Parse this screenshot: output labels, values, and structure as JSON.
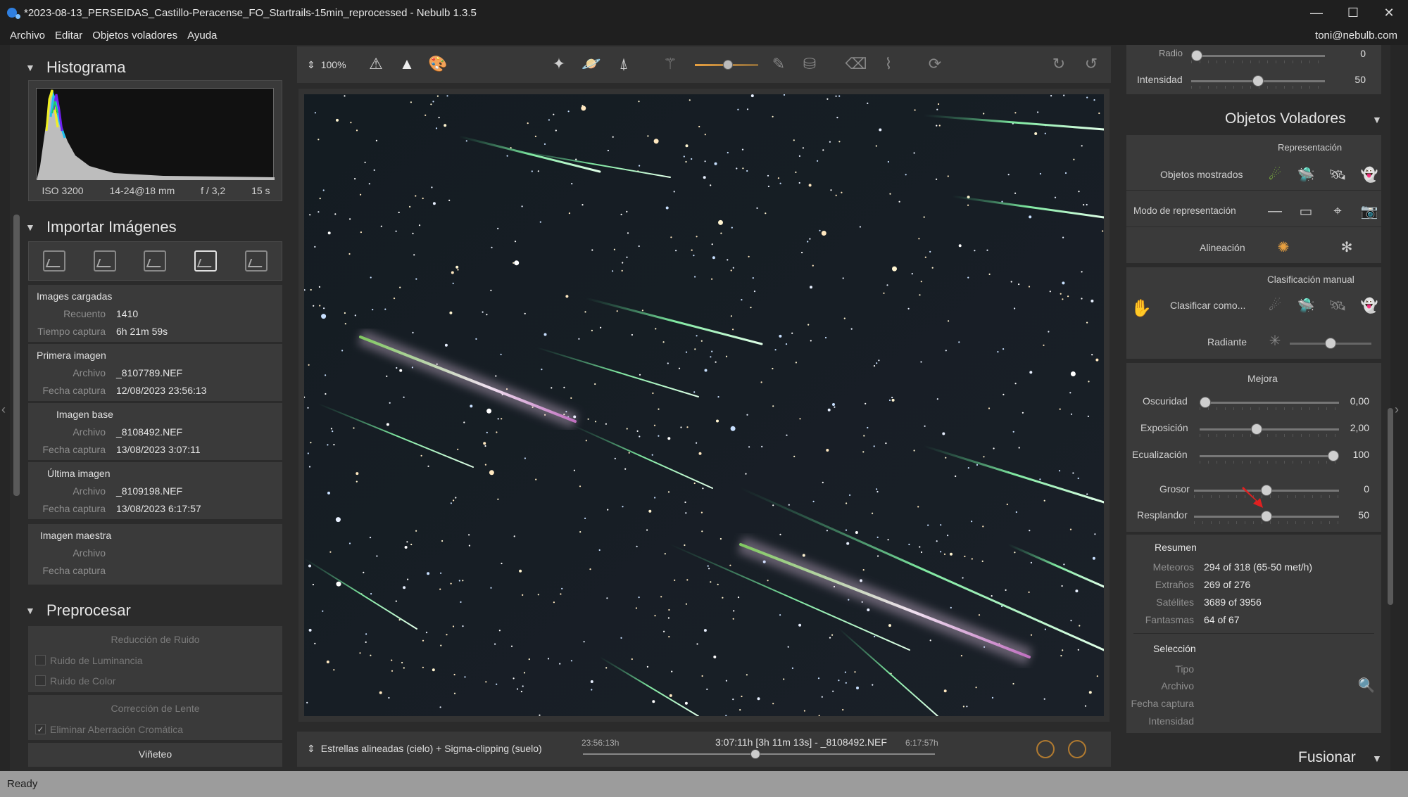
{
  "window": {
    "title": "*2023-08-13_PERSEIDAS_Castillo-Peracense_FO_Startrails-15min_reprocessed - Nebulb 1.3.5",
    "minimize": "—",
    "maximize": "☐",
    "close": "✕"
  },
  "menu": {
    "items": [
      "Archivo",
      "Editar",
      "Objetos voladores",
      "Ayuda"
    ],
    "user": "toni@nebulb.com"
  },
  "histogram": {
    "title": "Histograma",
    "iso": "ISO 3200",
    "lens": "14-24@18 mm",
    "aperture": "f / 3,2",
    "exposure": "15 s"
  },
  "import": {
    "title": "Importar Imágenes",
    "loaded": {
      "heading": "Images cargadas",
      "count_label": "Recuento",
      "count": "1410",
      "time_label": "Tiempo captura",
      "time": "6h 21m 59s"
    },
    "first": {
      "heading": "Primera imagen",
      "file_label": "Archivo",
      "file": "_8107789.NEF",
      "date_label": "Fecha captura",
      "date": "12/08/2023 23:56:13"
    },
    "base": {
      "heading": "Imagen base",
      "file_label": "Archivo",
      "file": "_8108492.NEF",
      "date_label": "Fecha captura",
      "date": "13/08/2023 3:07:11"
    },
    "last": {
      "heading": "Última imagen",
      "file_label": "Archivo",
      "file": "_8109198.NEF",
      "date_label": "Fecha captura",
      "date": "13/08/2023 6:17:57"
    },
    "master": {
      "heading": "Imagen maestra",
      "file_label": "Archivo",
      "date_label": "Fecha captura"
    }
  },
  "preprocess": {
    "title": "Preprocesar",
    "noise_heading": "Reducción de Ruido",
    "luminance": "Ruido de Luminancia",
    "color": "Ruido de Color",
    "lens_heading": "Corrección de Lente",
    "chromatic": "Eliminar Aberración Cromática",
    "chromatic_checked": true,
    "vignette": "Viñeteo"
  },
  "toolbar": {
    "zoom": "100%"
  },
  "timeline": {
    "mode": "Estrellas alineadas (cielo) + Sigma-clipping (suelo)",
    "start": "23:56:13h",
    "current": "3:07:11h [3h 11m 13s] - _8108492.NEF",
    "end": "6:17:57h",
    "position": 0.49
  },
  "right": {
    "top": {
      "radio_label": "Radio",
      "radio_value": "0",
      "intensity_label": "Intensidad",
      "intensity_value": "50",
      "intensity_level": 0.5
    },
    "flying": {
      "title": "Objetos Voladores",
      "representation": "Representación",
      "shown": "Objetos mostrados",
      "mode": "Modo de representación",
      "alignment": "Alineación",
      "manual": "Clasificación manual",
      "classify": "Clasificar como...",
      "radiant": "Radiante",
      "radiant_level": 0.5
    },
    "enhance": {
      "title": "Mejora",
      "darkness_label": "Oscuridad",
      "darkness_value": "0,00",
      "darkness_level": 0.0,
      "exposure_label": "Exposición",
      "exposure_value": "2,00",
      "exposure_level": 0.4,
      "equalization_label": "Ecualización",
      "equalization_value": "100",
      "equalization_level": 1.0,
      "thickness_label": "Grosor",
      "thickness_value": "0",
      "thickness_level": 0.5,
      "glow_label": "Resplandor",
      "glow_value": "50",
      "glow_level": 0.5
    },
    "summary": {
      "title": "Resumen",
      "meteors_label": "Meteoros",
      "meteors": "294 of 318 (65-50 met/h)",
      "strange_label": "Extraños",
      "strange": "269 of 276",
      "satellites_label": "Satélites",
      "satellites": "3689 of 3956",
      "ghosts_label": "Fantasmas",
      "ghosts": "64 of 67"
    },
    "selection": {
      "title": "Selección",
      "type": "Tipo",
      "file": "Archivo",
      "date": "Fecha captura",
      "intensity": "Intensidad"
    },
    "merge": "Fusionar"
  },
  "status": "Ready",
  "colors": {
    "accent": "#e8a040",
    "meteor_green": "#7ee8a0",
    "window_bg": "#2b2b2b",
    "panel_bg": "#3a3a3a",
    "annotation_arrow": "#e02020"
  }
}
